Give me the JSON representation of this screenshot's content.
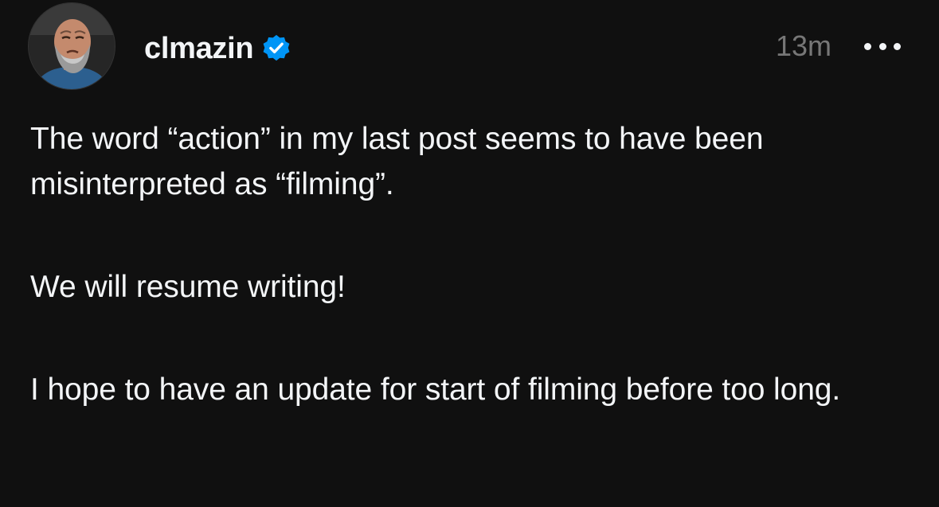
{
  "post": {
    "username": "clmazin",
    "verified": true,
    "timestamp": "13m",
    "paragraphs": [
      "The word “action” in my last post seems to have been misinterpreted as “filming”.",
      "We will resume writing!",
      "I hope to have an update for start of filming before too long."
    ]
  },
  "icons": {
    "avatar": "profile-photo",
    "verified": "verified-badge-icon",
    "more": "more-options-icon"
  },
  "colors": {
    "background": "#101010",
    "text": "#f3f5f7",
    "timestamp": "#777777",
    "verified": "#0095f6"
  }
}
